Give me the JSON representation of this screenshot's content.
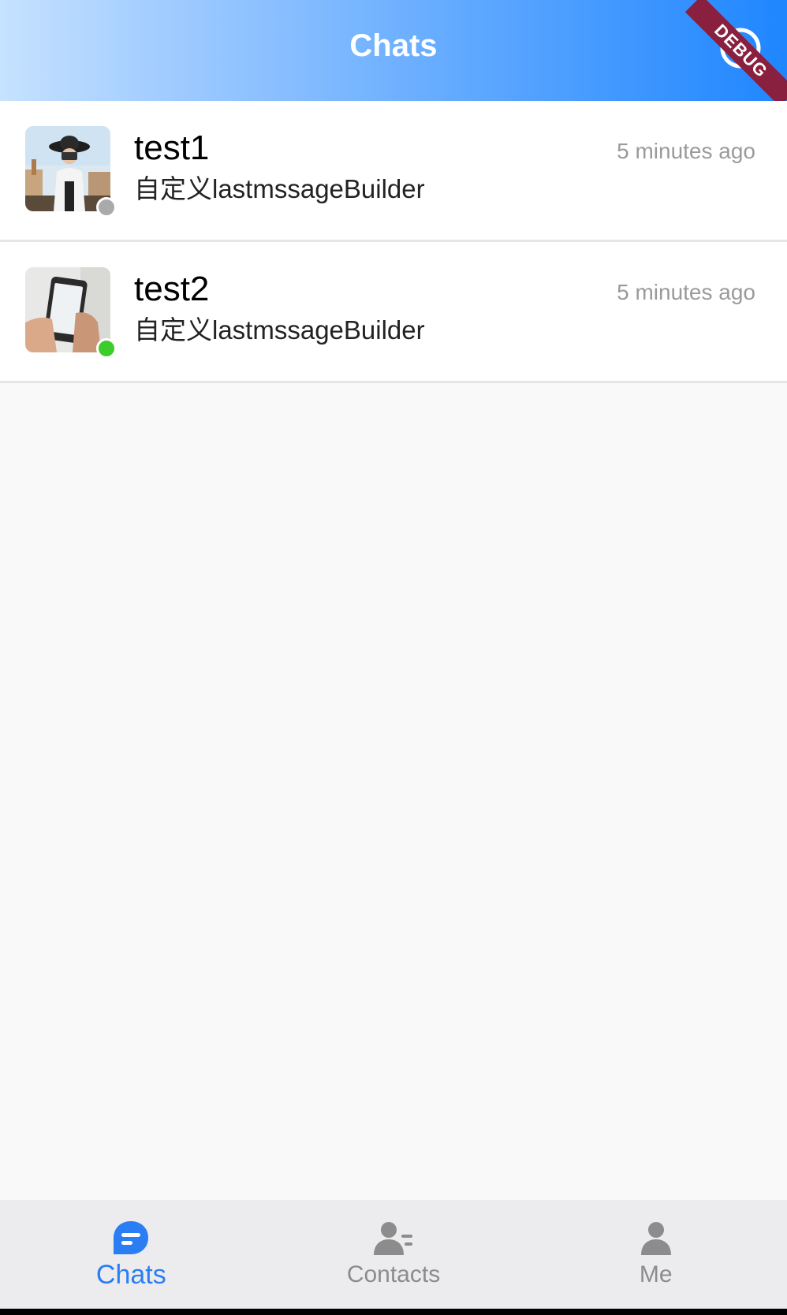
{
  "app_bar": {
    "title": "Chats",
    "add_icon": "plus-circle-icon",
    "debug_banner": "DEBUG",
    "colors": {
      "start": "#c6e2ff",
      "end": "#1f86ff"
    }
  },
  "chats": [
    {
      "name": "test1",
      "preview": "自定义lastmssageBuilder",
      "time": "5 minutes ago",
      "presence": "offline",
      "presence_color": "#aaaaaa",
      "avatar": "woman-with-camera-photo"
    },
    {
      "name": "test2",
      "preview": "自定义lastmssageBuilder",
      "time": "5 minutes ago",
      "presence": "online",
      "presence_color": "#3ccc2b",
      "avatar": "hand-holding-phone-photo"
    }
  ],
  "bottom_nav": {
    "active_color": "#2b7df4",
    "inactive_color": "#8c8c8c",
    "tabs": [
      {
        "label": "Chats",
        "icon": "chat-bubble-icon",
        "active": true
      },
      {
        "label": "Contacts",
        "icon": "contacts-icon",
        "active": false
      },
      {
        "label": "Me",
        "icon": "person-icon",
        "active": false
      }
    ]
  }
}
